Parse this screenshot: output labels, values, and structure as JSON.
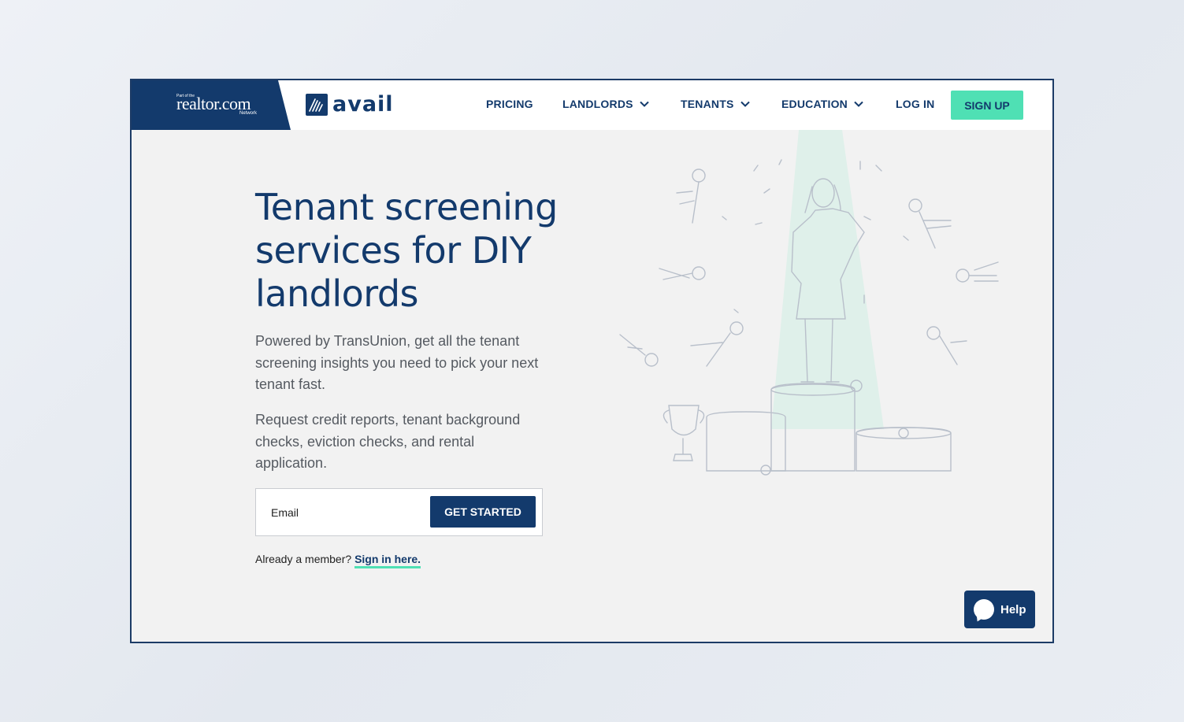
{
  "header": {
    "realtor_top": "Part of the",
    "realtor_logo": "realtor.com",
    "realtor_bottom": "Network",
    "brand": "avail",
    "nav": [
      {
        "label": "PRICING",
        "dropdown": false
      },
      {
        "label": "LANDLORDS",
        "dropdown": true
      },
      {
        "label": "TENANTS",
        "dropdown": true
      },
      {
        "label": "EDUCATION",
        "dropdown": true
      },
      {
        "label": "LOG IN",
        "dropdown": false
      }
    ],
    "signup_label": "SIGN UP"
  },
  "hero": {
    "title": "Tenant screening services for DIY landlords",
    "paragraph1": "Powered by TransUnion, get all the tenant screening insights you need to pick your next tenant fast.",
    "paragraph2": "Request credit reports, tenant background checks, eviction checks, and rental application.",
    "email_placeholder": "Email",
    "cta_label": "GET STARTED",
    "member_text": "Already a member?",
    "signin_link": "Sign in here."
  },
  "help": {
    "label": "Help"
  },
  "colors": {
    "navy": "#133a6c",
    "mint": "#4fe0b4",
    "background": "#f2f2f2"
  },
  "icons": [
    "chevron-down-icon",
    "avail-logo-icon",
    "chat-bubble-icon"
  ]
}
